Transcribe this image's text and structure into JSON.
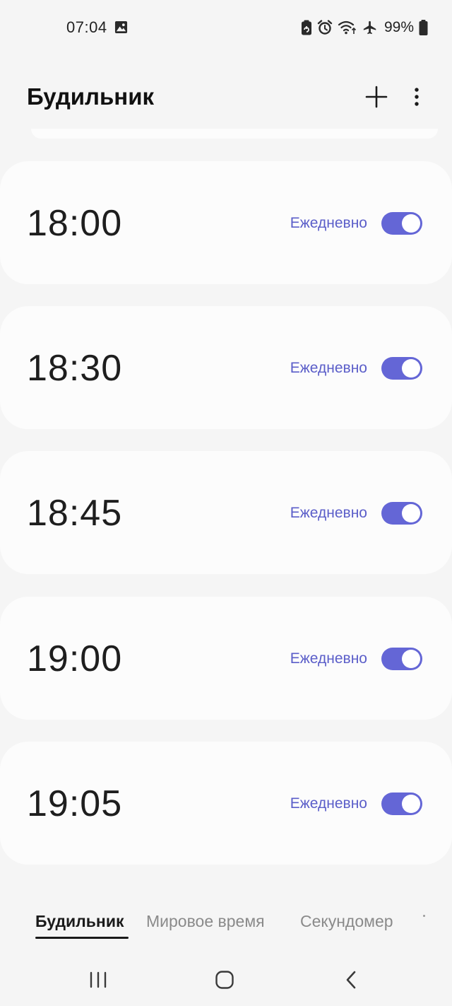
{
  "status_bar": {
    "time": "07:04",
    "battery_percent": "99%",
    "icons": [
      "gallery-icon",
      "battery-saver-icon",
      "alarm-icon",
      "wifi-icon",
      "airplane-icon",
      "battery-icon"
    ]
  },
  "header": {
    "title": "Будильник",
    "add_icon": "plus-icon",
    "more_icon": "more-vertical-icon"
  },
  "alarms": [
    {
      "time": "18:00",
      "repeat": "Ежедневно",
      "enabled": true
    },
    {
      "time": "18:30",
      "repeat": "Ежедневно",
      "enabled": true
    },
    {
      "time": "18:45",
      "repeat": "Ежедневно",
      "enabled": true
    },
    {
      "time": "19:00",
      "repeat": "Ежедневно",
      "enabled": true
    },
    {
      "time": "19:05",
      "repeat": "Ежедневно",
      "enabled": true
    }
  ],
  "tabs": [
    {
      "label": "Будильник",
      "active": true
    },
    {
      "label": "Мировое время",
      "active": false
    },
    {
      "label": "Секундомер",
      "active": false
    }
  ],
  "nav": {
    "icons": [
      "recents-icon",
      "home-icon",
      "back-icon"
    ]
  },
  "colors": {
    "accent": "#6466d6",
    "repeat_text": "#5b5ec9",
    "background": "#f5f5f5",
    "card": "#fcfcfc"
  }
}
